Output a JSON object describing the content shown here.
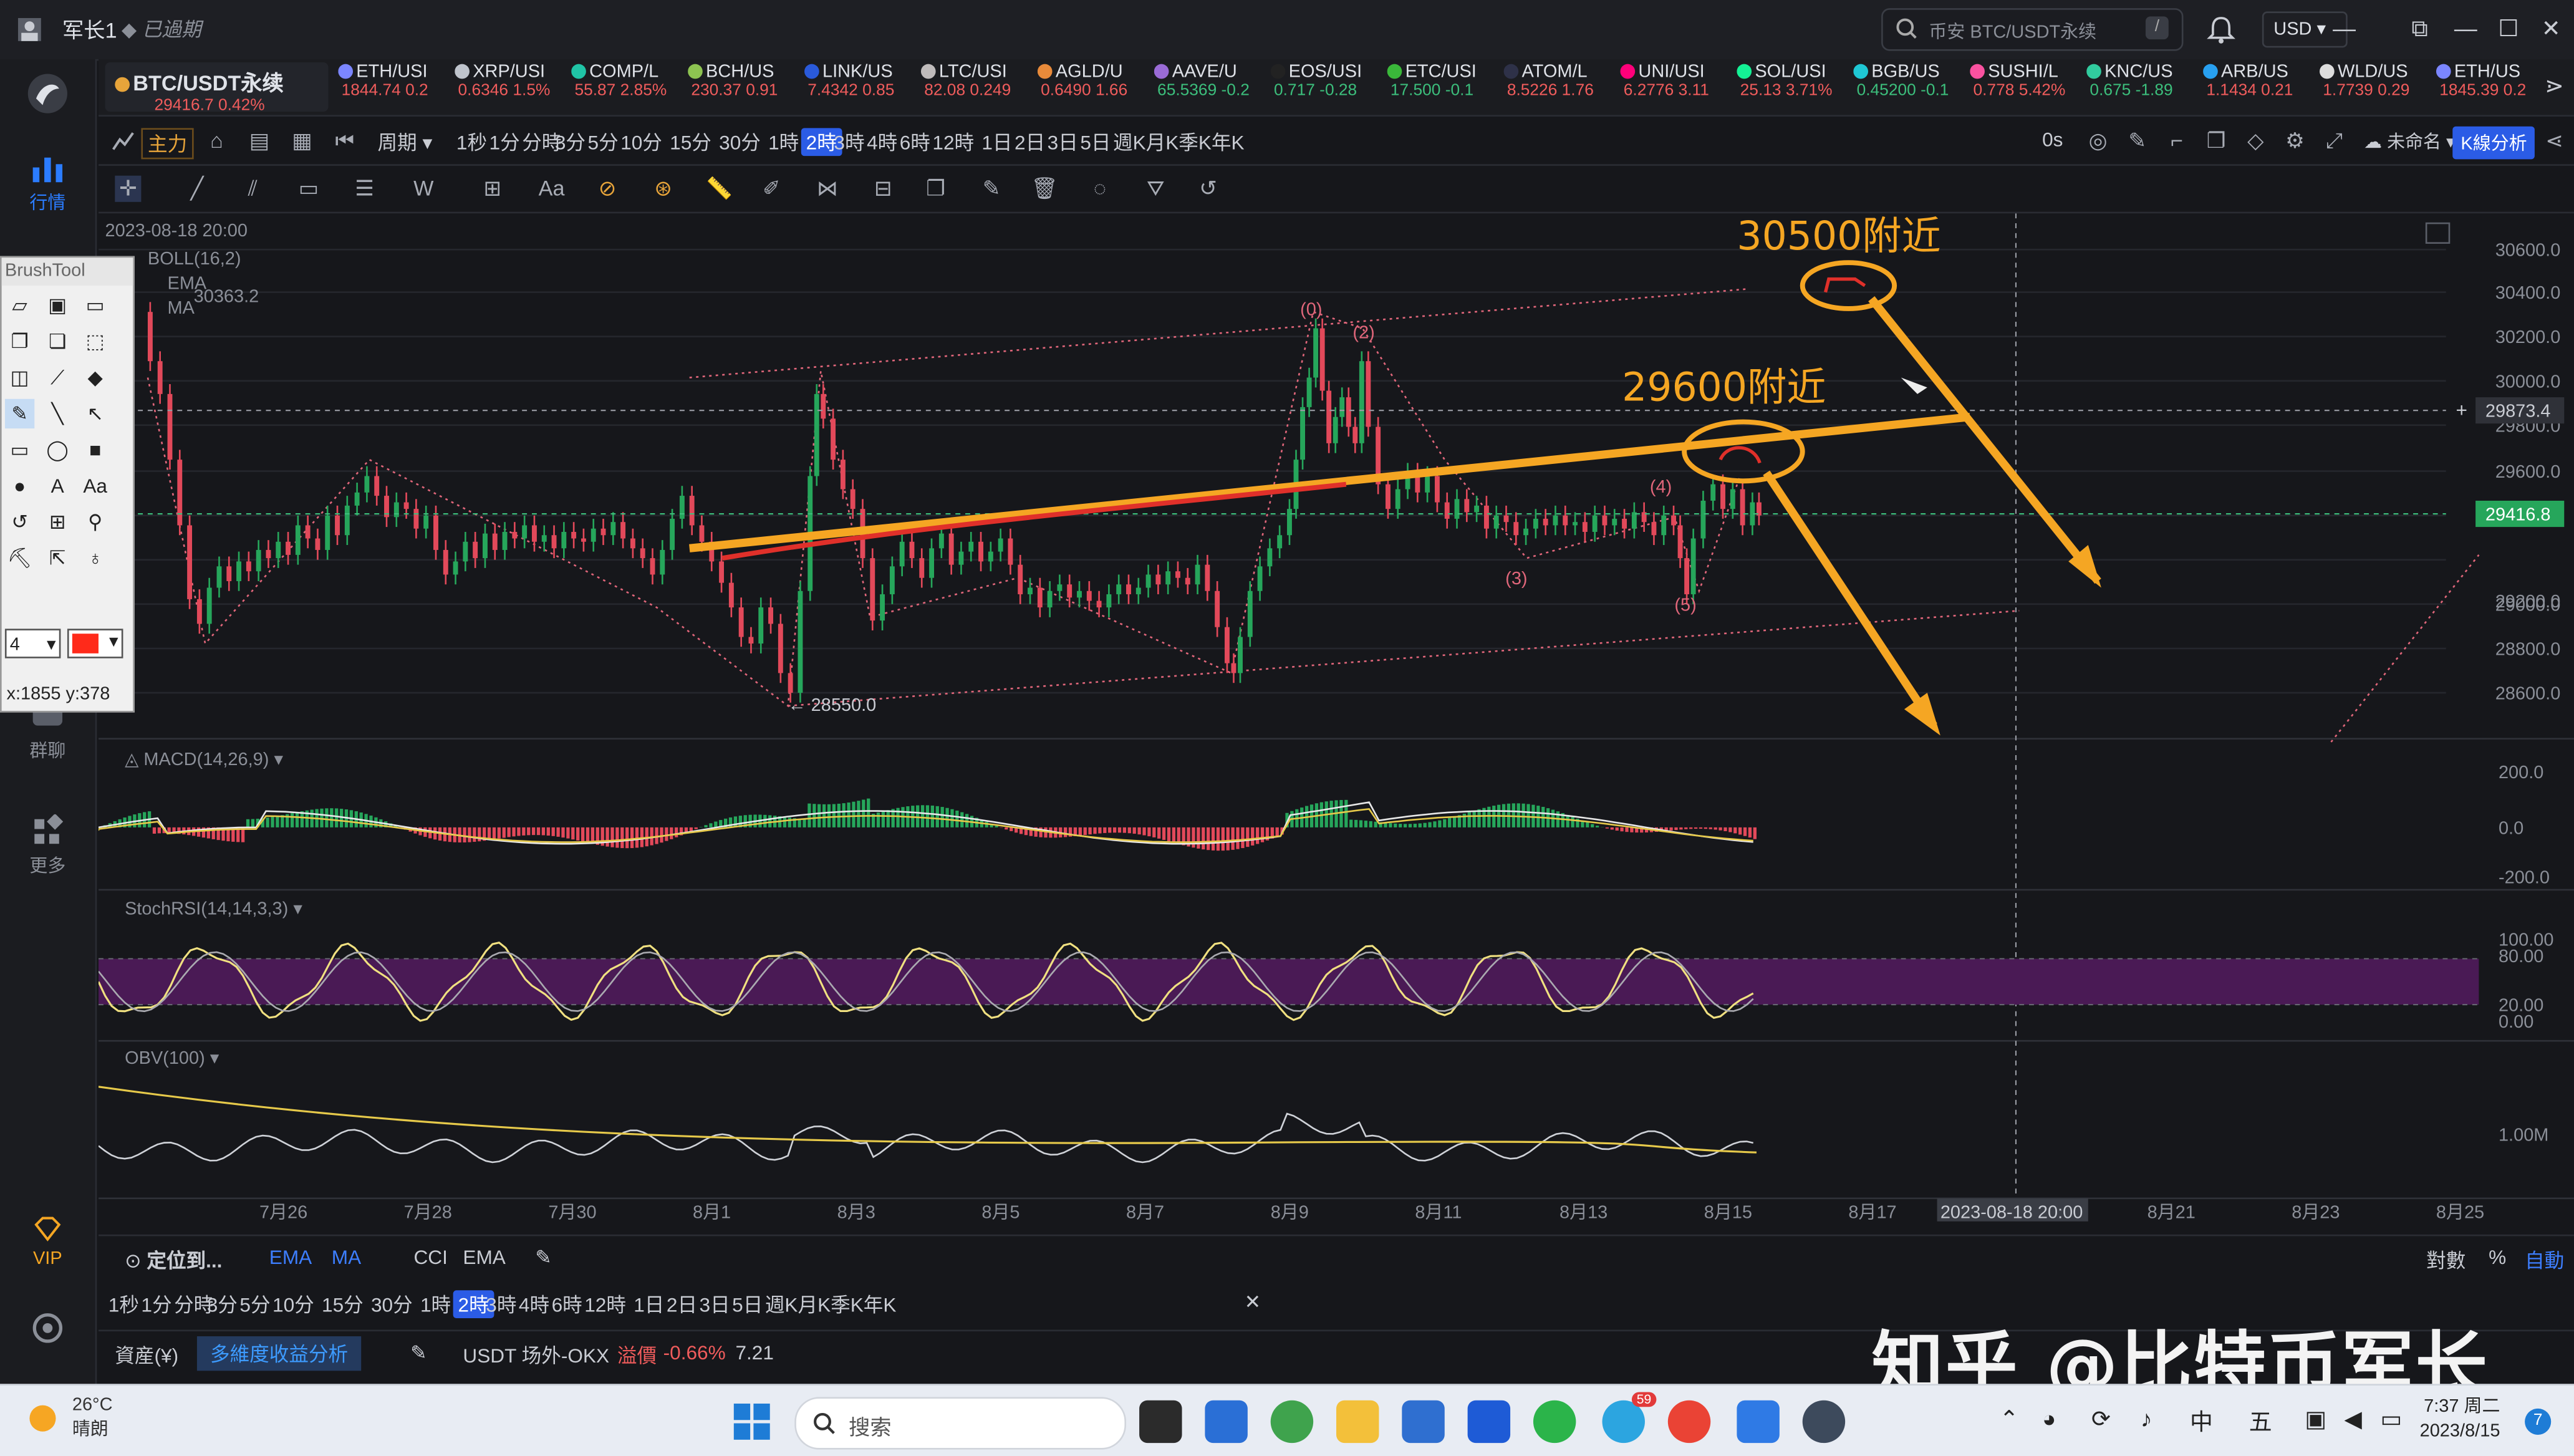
{
  "titlebar": {
    "user": "军长1",
    "status": "已過期",
    "search_placeholder": "币安 BTC/USDT永续",
    "search_shortcut": "/",
    "currency": "USD"
  },
  "sidebar": {
    "items": [
      {
        "label": "行情",
        "icon": "bar-chart-icon"
      },
      {
        "label": "群聊",
        "icon": "chat-icon"
      },
      {
        "label": "更多",
        "icon": "grid-icon"
      },
      {
        "label": "VIP",
        "icon": "diamond-icon"
      }
    ]
  },
  "tickers": {
    "main": {
      "symbol": "BTC/USDT永续",
      "price": "29416.7",
      "change": "0.42%"
    },
    "items": [
      {
        "symbol": "ETH/USI",
        "line2": "1844.74  0.2"
      },
      {
        "symbol": "XRP/USI",
        "line2": "0.6346  1.5%"
      },
      {
        "symbol": "COMP/L",
        "line2": "55.87  2.85%"
      },
      {
        "symbol": "BCH/US",
        "line2": "230.37  0.91"
      },
      {
        "symbol": "LINK/US",
        "line2": "7.4342  0.85"
      },
      {
        "symbol": "LTC/USI",
        "line2": "82.08  0.249"
      },
      {
        "symbol": "AGLD/U",
        "line2": "0.6490  1.66"
      },
      {
        "symbol": "AAVE/U",
        "line2": "65.5369  -0.2"
      },
      {
        "symbol": "EOS/USI",
        "line2": "0.717  -0.28"
      },
      {
        "symbol": "ETC/USI",
        "line2": "17.500  -0.1"
      },
      {
        "symbol": "ATOM/L",
        "line2": "8.5226  1.76"
      },
      {
        "symbol": "UNI/USI",
        "line2": "6.2776  3.11"
      },
      {
        "symbol": "SOL/USI",
        "line2": "25.13  3.71%"
      },
      {
        "symbol": "BGB/US",
        "line2": "0.45200  -0.1"
      },
      {
        "symbol": "SUSHI/L",
        "line2": "0.778  5.42%"
      },
      {
        "symbol": "KNC/US",
        "line2": "0.675  -1.89"
      },
      {
        "symbol": "ARB/US",
        "line2": "1.1434  0.21"
      },
      {
        "symbol": "WLD/US",
        "line2": "1.7739  0.29"
      },
      {
        "symbol": "ETH/US",
        "line2": "1845.39  0.2"
      }
    ]
  },
  "toolbar1": {
    "zhuli": "主力",
    "period": "周期",
    "timeframes": [
      "1秒",
      "1分",
      "分時",
      "3分",
      "5分",
      "10分",
      "15分",
      "30分",
      "1時",
      "2時",
      "3時",
      "4時",
      "6時",
      "12時",
      "1日",
      "2日",
      "3日",
      "5日",
      "週K",
      "月K",
      "季K",
      "年K"
    ],
    "active_tf": "2時",
    "counter": "0s",
    "unnamed": "未命名",
    "kline_analysis": "K線分析"
  },
  "brush_panel": {
    "title": "BrushTool",
    "size": "4",
    "color": "#ff2a1a",
    "coords": "x:1855 y:378"
  },
  "chart": {
    "date_header": "2023-08-18 20:00",
    "indicators_main": [
      "BOLL(16,2)",
      "EMA",
      "MA"
    ],
    "price_axis": [
      "30600.0",
      "30400.0",
      "30200.0",
      "30000.0",
      "29800.0",
      "29600.0",
      "29400.0",
      "29200.0",
      "29000.0",
      "28800.0",
      "28600.0"
    ],
    "crosshair_price": "29873.4",
    "last_price": "29416.8",
    "low_marker": "28550.0",
    "high_marker": "30363.2",
    "wave_labels": [
      "(0)",
      "(2)",
      "(3)",
      "(4)",
      "(5)"
    ],
    "annotations": [
      "30500附近",
      "29600附近"
    ],
    "annotation_color": "#f5a623",
    "x_axis": [
      "7月26",
      "7月28",
      "7月30",
      "8月1",
      "8月3",
      "8月5",
      "8月7",
      "8月9",
      "8月11",
      "8月13",
      "8月15",
      "8月17",
      "2023-08-18 20:00",
      "8月21",
      "8月23",
      "8月25"
    ],
    "macd": {
      "title": "MACD(14,26,9)",
      "axis": [
        "200.0",
        "0.0",
        "-200.0"
      ]
    },
    "stochrsi": {
      "title": "StochRSI(14,14,3,3)",
      "axis": [
        "100.00",
        "80.00",
        "20.00",
        "0.00"
      ]
    },
    "obv": {
      "title": "OBV(100)",
      "axis": [
        "1.00M"
      ]
    }
  },
  "bottom": {
    "locate": "定位到...",
    "indicators": [
      "EMA",
      "MA",
      "CCI",
      "EMA"
    ],
    "log_scale": "對數",
    "percent": "%",
    "auto": "自動",
    "timeframes": [
      "1秒",
      "1分",
      "分時",
      "3分",
      "5分",
      "10分",
      "15分",
      "30分",
      "1時",
      "2時",
      "3時",
      "4時",
      "6時",
      "12時",
      "1日",
      "2日",
      "3日",
      "5日",
      "週K",
      "月K",
      "季K",
      "年K"
    ],
    "active_tf": "2時",
    "assets": "資産(¥)",
    "multi": "多維度收益分析",
    "usdt": "USDT 场外-OKX",
    "premium_label": "溢價",
    "premium": "-0.66%",
    "rate": "7.21"
  },
  "watermark": "知乎 @比特币军长",
  "taskbar": {
    "temp": "26°C",
    "weather": "晴朗",
    "search": "搜索",
    "ime1": "中",
    "ime2": "五",
    "time": "7:37 周二",
    "date": "2023/8/15",
    "badge_telegram": "59",
    "notification_count": "7"
  }
}
